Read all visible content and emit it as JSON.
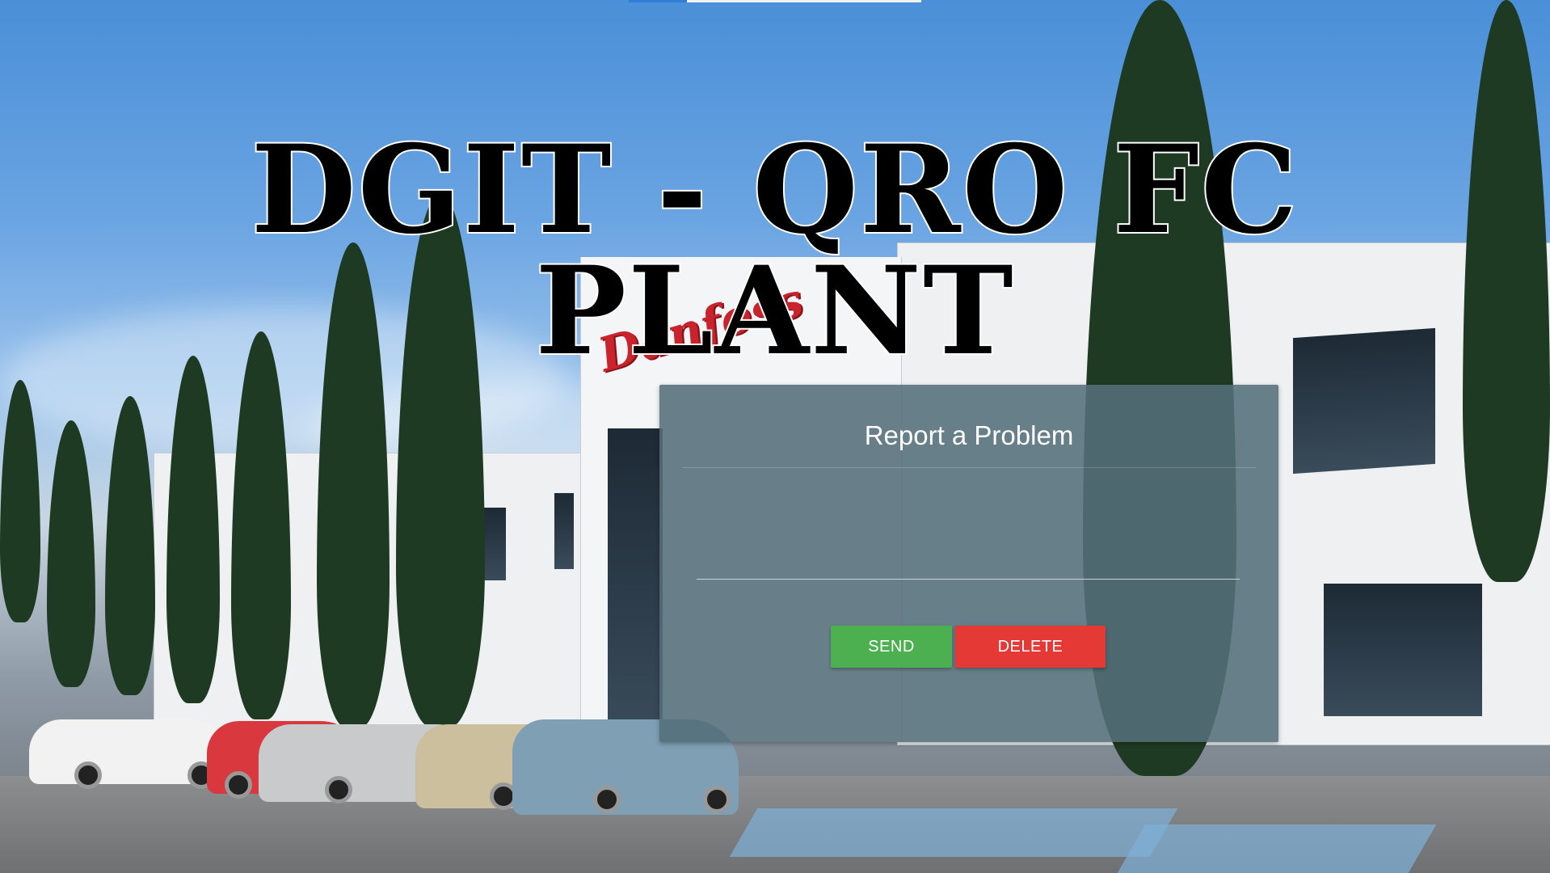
{
  "header": {
    "title": "DGIT - QRO FC PLANT"
  },
  "background": {
    "logo_text": "Danfoss"
  },
  "report_panel": {
    "title": "Report a Problem",
    "input_value": "",
    "send_label": "SEND",
    "delete_label": "DELETE"
  },
  "colors": {
    "send_button": "#4caf50",
    "delete_button": "#e53935",
    "panel_background": "#546e7a",
    "title_text": "#000000"
  }
}
